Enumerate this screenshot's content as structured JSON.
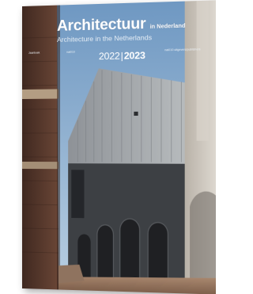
{
  "cover": {
    "title": "Architectuur",
    "title_suffix": "in Nederland",
    "subtitle": "Architecture in the Netherlands",
    "editors_left": "Jaarboek",
    "editors_mid": "nai010",
    "publisher": "nai010 uitgevers/publishers",
    "year_start": "2022",
    "year_separator": "|",
    "year_end": "2023"
  },
  "colors": {
    "sky": "#8fb3d3",
    "facade_light": "#a5a9ac",
    "facade_dark": "#3d4044",
    "brick": "#5a3a2c",
    "pavement": "#9c7a63",
    "column": "#cfc9c1"
  }
}
